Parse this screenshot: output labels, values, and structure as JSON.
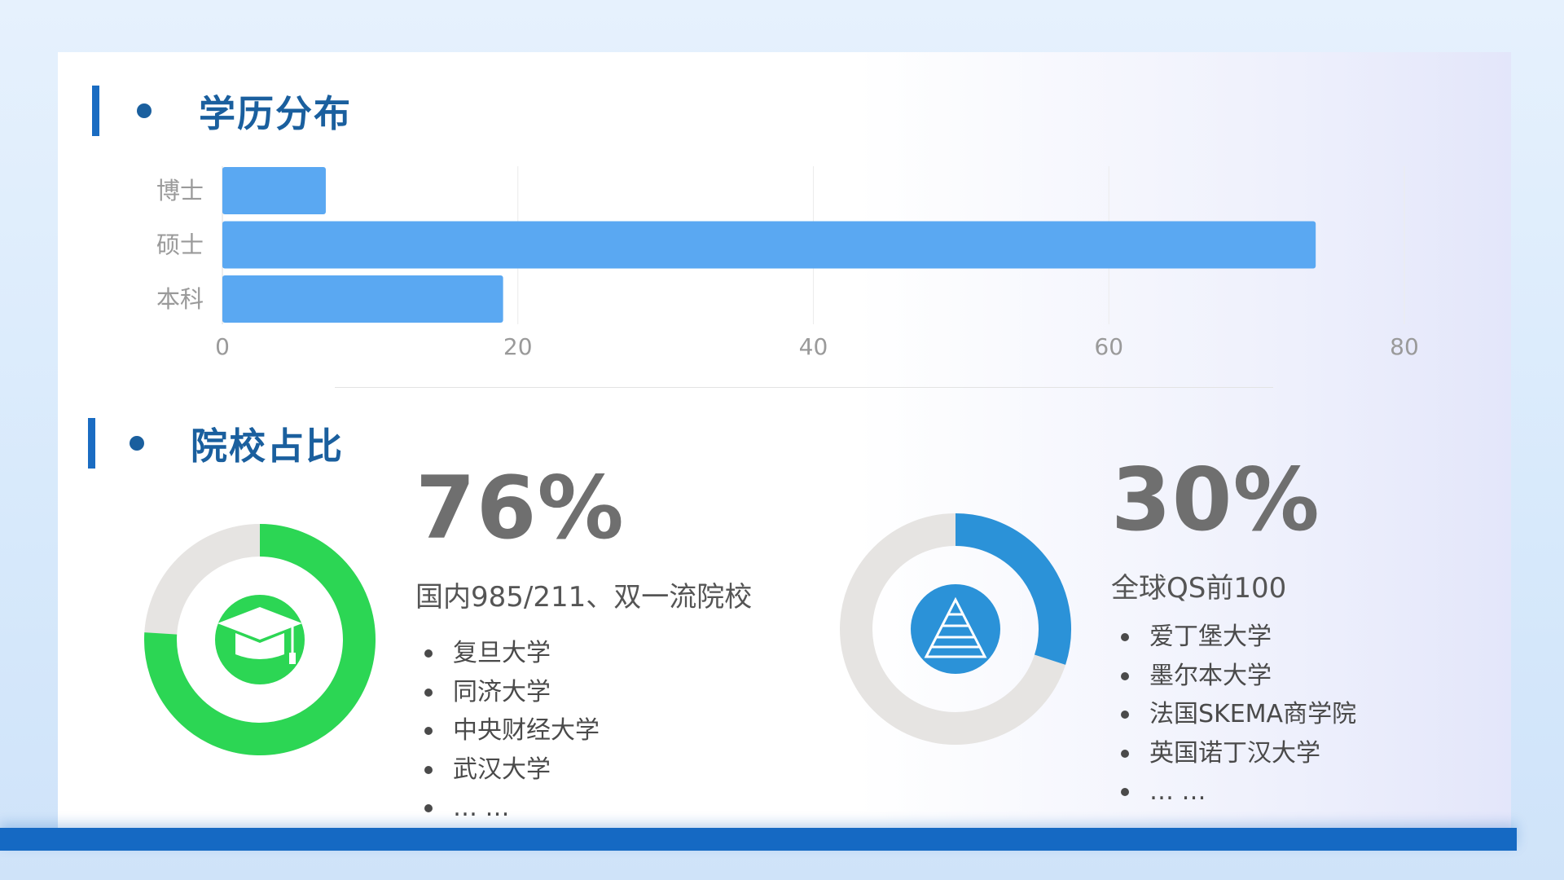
{
  "section1": {
    "title": "学历分布"
  },
  "section2": {
    "title": "院校占比"
  },
  "chart_data": [
    {
      "type": "bar",
      "orientation": "horizontal",
      "categories": [
        "博士",
        "硕士",
        "本科"
      ],
      "values": [
        7,
        74,
        19
      ],
      "xlim": [
        0,
        80
      ],
      "xticks": [
        "0",
        "20",
        "40",
        "60",
        "80"
      ],
      "grid": true,
      "colors": {
        "bar": "#5aa8f2",
        "tick": "#9a9a9a",
        "grid": "#ececec"
      }
    },
    {
      "type": "pie",
      "variant": "donut",
      "label": "76%",
      "values": [
        76,
        24
      ],
      "colors": [
        "#2cd654",
        "#e6e4e2"
      ],
      "icon": "graduation-cap-icon"
    },
    {
      "type": "pie",
      "variant": "donut",
      "label": "30%",
      "values": [
        30,
        70
      ],
      "colors": [
        "#2b92d8",
        "#e6e4e2"
      ],
      "icon": "pyramid-icon"
    }
  ],
  "left_panel": {
    "percent": "76%",
    "subtitle": "国内985/211、双一流院校",
    "items": [
      "复旦大学",
      "同济大学",
      "中央财经大学",
      "武汉大学",
      "… …"
    ]
  },
  "right_panel": {
    "percent": "30%",
    "subtitle": "全球QS前100",
    "items": [
      "爱丁堡大学",
      "墨尔本大学",
      "法国SKEMA商学院",
      "英国诺丁汉大学",
      "… …"
    ]
  },
  "colors": {
    "heading": "#1a5f9e",
    "accent_bar": "#1a6cc2",
    "bottom_band": "#1569c3"
  }
}
